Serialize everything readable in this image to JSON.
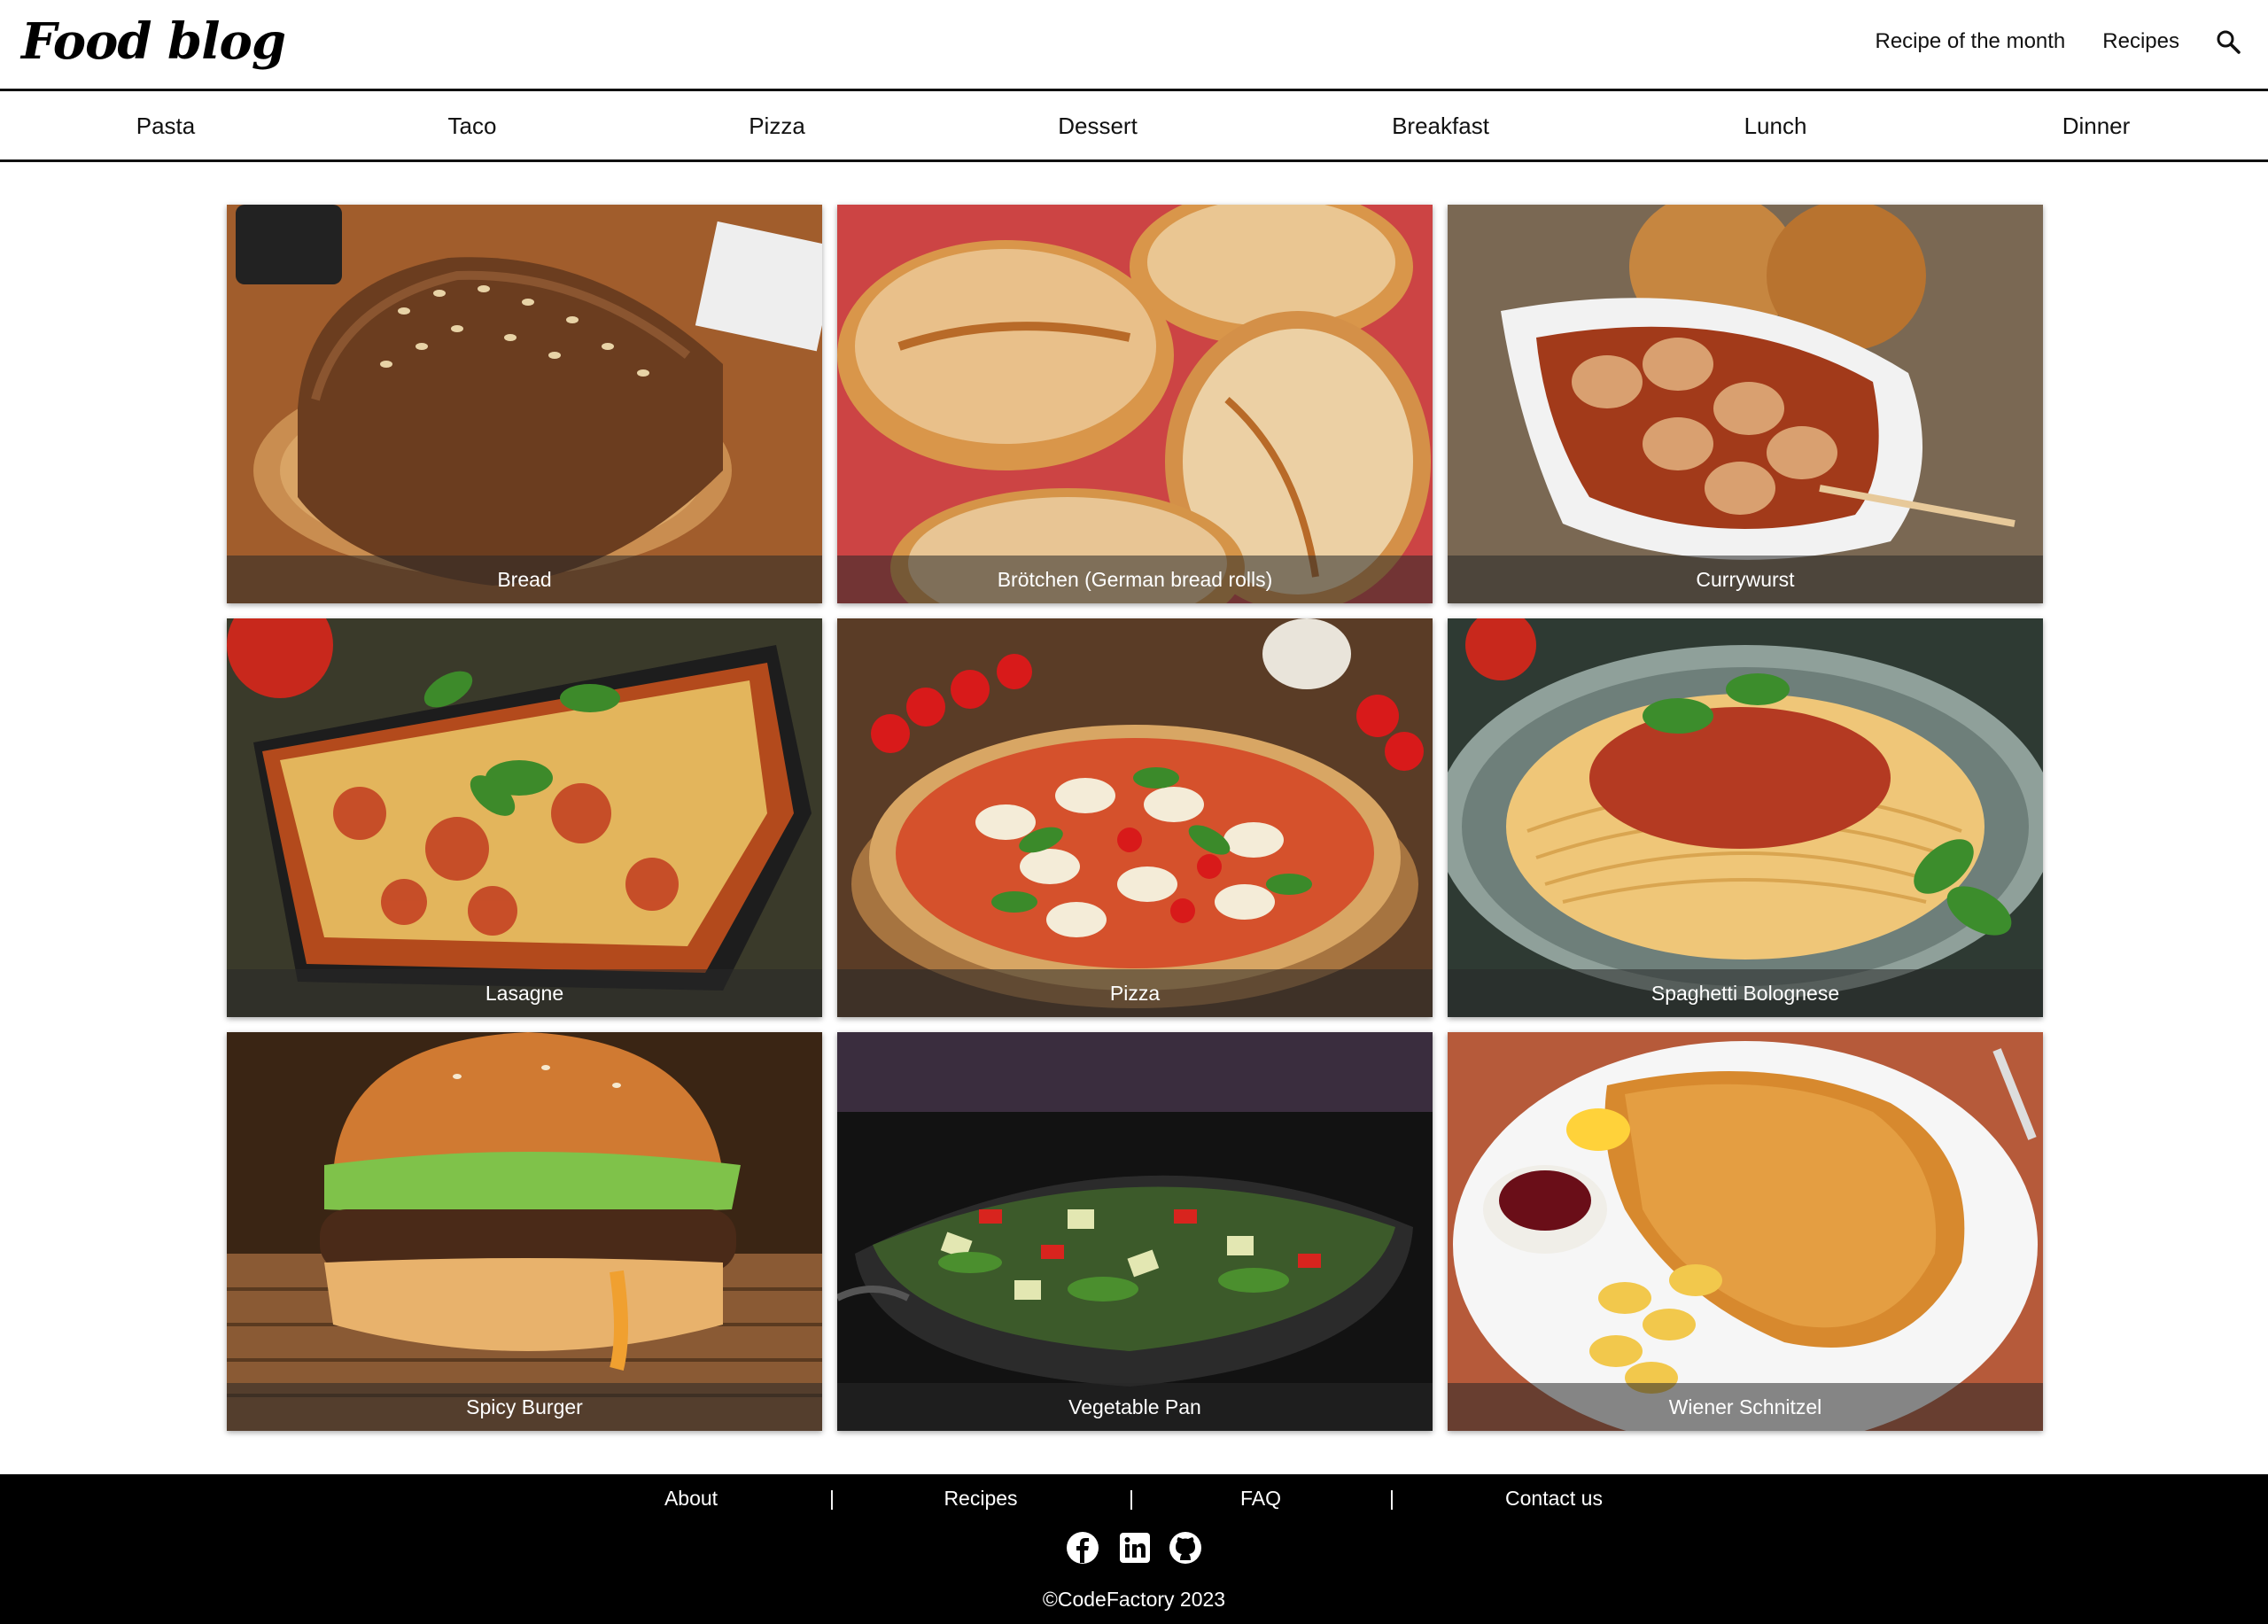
{
  "header": {
    "logo": "Food blog",
    "nav": [
      "Recipe of the month",
      "Recipes"
    ],
    "search_icon": "search-icon"
  },
  "categories": [
    "Pasta",
    "Taco",
    "Pizza",
    "Dessert",
    "Breakfast",
    "Lunch",
    "Dinner"
  ],
  "recipes": [
    {
      "title": "Bread"
    },
    {
      "title": "Brötchen (German bread rolls)"
    },
    {
      "title": "Currywurst"
    },
    {
      "title": "Lasagne"
    },
    {
      "title": "Pizza"
    },
    {
      "title": "Spaghetti Bolognese"
    },
    {
      "title": "Spicy Burger"
    },
    {
      "title": "Vegetable Pan"
    },
    {
      "title": "Wiener Schnitzel"
    }
  ],
  "footer": {
    "links": [
      "About",
      "Recipes",
      "FAQ",
      "Contact us"
    ],
    "separator": "|",
    "social_icons": [
      "facebook-icon",
      "linkedin-icon",
      "github-icon"
    ],
    "copyright": "©CodeFactory 2023"
  },
  "colors": {
    "background": "#ffffff",
    "text": "#111111",
    "footer_bg": "#000000",
    "caption_bg": "rgba(40,40,40,0.55)"
  }
}
